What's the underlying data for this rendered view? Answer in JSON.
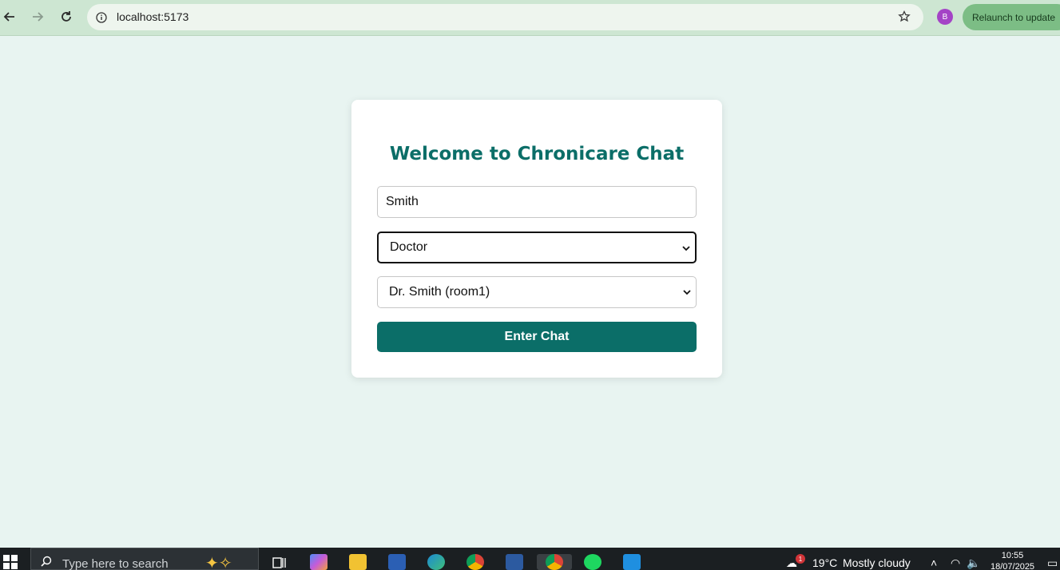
{
  "browser": {
    "url": "localhost:5173",
    "profile_initial": "B",
    "relaunch_label": "Relaunch to update"
  },
  "login": {
    "title": "Welcome to Chronicare Chat",
    "name_value": "Smith",
    "role_selected": "Doctor",
    "room_selected": "Dr. Smith (room1)",
    "enter_label": "Enter Chat"
  },
  "taskbar": {
    "search_placeholder": "Type here to search",
    "notification_count": "1",
    "weather_temp": "19°C",
    "weather_text": "Mostly cloudy",
    "time": "10:55",
    "date": "18/07/2025"
  },
  "colors": {
    "accent": "#0b6e68",
    "page_bg": "#e8f4f1",
    "chrome_bg": "#cde6d2"
  }
}
